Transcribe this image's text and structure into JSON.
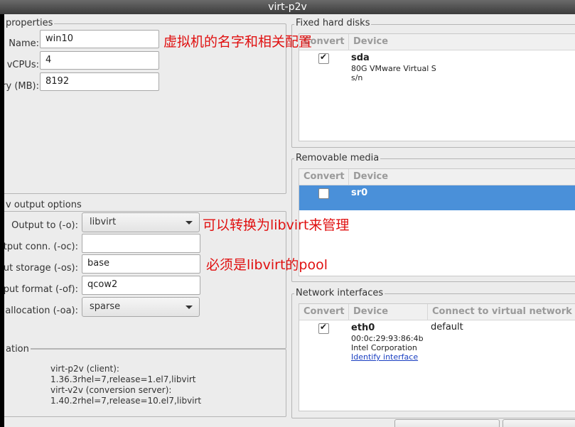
{
  "window": {
    "title": "virt-p2v"
  },
  "target_properties": {
    "legend": "properties",
    "name_label": "Name:",
    "name_value": "win10",
    "vcpus_label": "vCPUs:",
    "vcpus_value": "4",
    "memory_label": "ry (MB):",
    "memory_value": "8192"
  },
  "output_options": {
    "legend": "v output options",
    "output_to_label": "Output to (-o):",
    "output_to_value": "libvirt",
    "output_conn_label": "utput conn. (-oc):",
    "output_conn_value": "",
    "output_storage_label": "ut storage (-os):",
    "output_storage_value": "base",
    "output_format_label": "tput format (-of):",
    "output_format_value": "qcow2",
    "output_allocation_label": "t allocation (-oa):",
    "output_allocation_value": "sparse"
  },
  "information": {
    "legend": "ation",
    "client_label": "virt-p2v (client):",
    "client_version": "1.36.3rhel=7,release=1.el7,libvirt",
    "server_label": "virt-v2v (conversion server):",
    "server_version": "1.40.2rhel=7,release=10.el7,libvirt"
  },
  "fixed_hard_disks": {
    "legend": "Fixed hard disks",
    "col_convert": "Convert",
    "col_device": "Device",
    "rows": [
      {
        "checked": true,
        "device": "sda",
        "detail1": "80G VMware Virtual S",
        "detail2": "s/n"
      }
    ]
  },
  "removable_media": {
    "legend": "Removable media",
    "col_convert": "Convert",
    "col_device": "Device",
    "rows": [
      {
        "checked": false,
        "device": "sr0",
        "selected": true
      }
    ]
  },
  "network_interfaces": {
    "legend": "Network interfaces",
    "col_convert": "Convert",
    "col_device": "Device",
    "col_connect": "Connect to virtual network",
    "rows": [
      {
        "checked": true,
        "device": "eth0",
        "mac": "00:0c:29:93:86:4b",
        "vendor": "Intel Corporation",
        "identify_link": "Identify interface",
        "network": "default"
      }
    ]
  },
  "annotations": {
    "vm_note": "虚拟机的名字和相关配置",
    "libvirt_note": "可以转换为libvirt来管理",
    "pool_note": "必须是libvirt的pool"
  },
  "colors": {
    "annotation": "#e01010",
    "selection": "#4a90d9",
    "window_bg": "#ececec"
  }
}
